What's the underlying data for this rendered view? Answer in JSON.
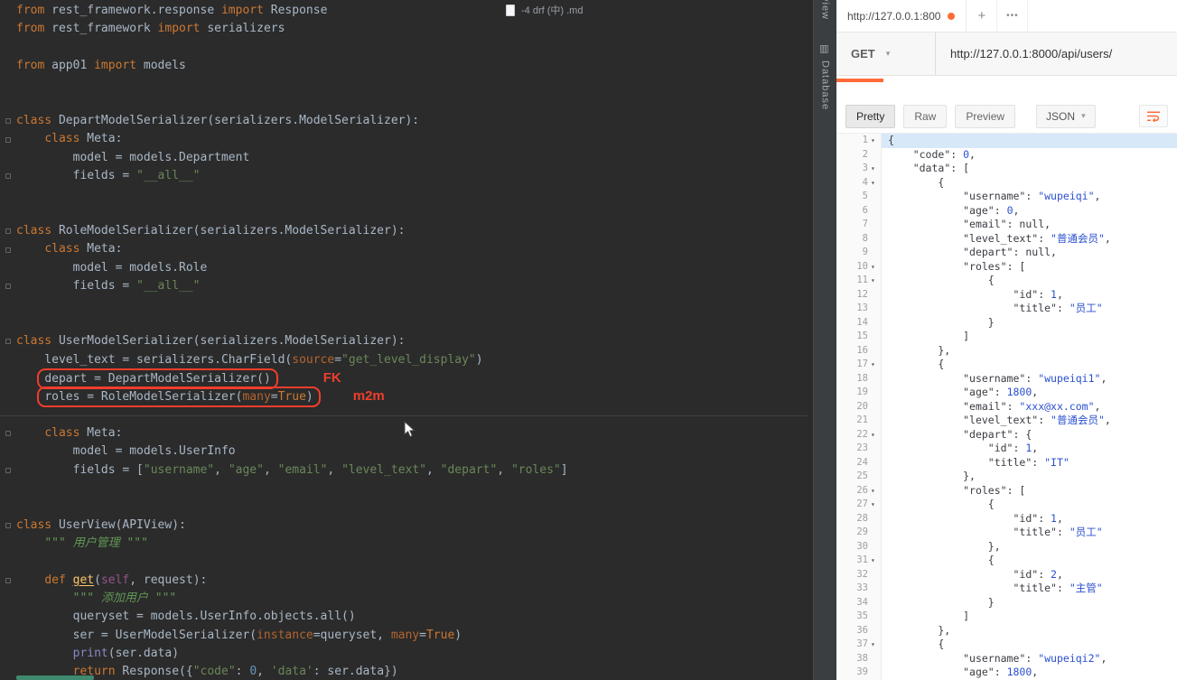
{
  "colors": {
    "accent": "#ff6c37",
    "annotation_red": "#f03e2d"
  },
  "editor": {
    "tab_filename": "-4 drf (中) .md",
    "tool_stripe": {
      "top": "view",
      "side": "Database"
    },
    "code_lines": [
      {
        "t": [
          [
            "k",
            "from"
          ],
          [
            "p",
            " rest_framework.response "
          ],
          [
            "k",
            "import"
          ],
          [
            "p",
            " Response"
          ]
        ]
      },
      {
        "t": [
          [
            "k",
            "from"
          ],
          [
            "p",
            " rest_framework "
          ],
          [
            "k",
            "import"
          ],
          [
            "p",
            " serializers"
          ]
        ]
      },
      {
        "t": []
      },
      {
        "t": [
          [
            "k",
            "from"
          ],
          [
            "p",
            " app01 "
          ],
          [
            "k",
            "import"
          ],
          [
            "p",
            " models"
          ]
        ]
      },
      {
        "t": []
      },
      {
        "t": []
      },
      {
        "f": 1,
        "t": [
          [
            "k",
            "class"
          ],
          [
            "p",
            " DepartModelSerializer(serializers.ModelSerializer):"
          ]
        ]
      },
      {
        "f": 1,
        "t": [
          [
            "p",
            "    "
          ],
          [
            "k",
            "class"
          ],
          [
            "p",
            " Meta:"
          ]
        ]
      },
      {
        "t": [
          [
            "p",
            "        model = models.Department"
          ]
        ]
      },
      {
        "f": 1,
        "t": [
          [
            "p",
            "        fields = "
          ],
          [
            "s",
            "\"__all__\""
          ]
        ]
      },
      {
        "t": []
      },
      {
        "t": []
      },
      {
        "f": 1,
        "t": [
          [
            "k",
            "class"
          ],
          [
            "p",
            " RoleModelSerializer(serializers.ModelSerializer):"
          ]
        ]
      },
      {
        "f": 1,
        "t": [
          [
            "p",
            "    "
          ],
          [
            "k",
            "class"
          ],
          [
            "p",
            " Meta:"
          ]
        ]
      },
      {
        "t": [
          [
            "p",
            "        model = models.Role"
          ]
        ]
      },
      {
        "f": 1,
        "t": [
          [
            "p",
            "        fields = "
          ],
          [
            "s",
            "\"__all__\""
          ]
        ]
      },
      {
        "t": []
      },
      {
        "t": []
      },
      {
        "f": 1,
        "t": [
          [
            "k",
            "class"
          ],
          [
            "p",
            " UserModelSerializer(serializers.ModelSerializer):"
          ]
        ]
      },
      {
        "t": [
          [
            "p",
            "    level_text = serializers.CharField("
          ],
          [
            "a",
            "source"
          ],
          [
            "p",
            "="
          ],
          [
            "s",
            "\"get_level_display\""
          ],
          [
            "p",
            ")"
          ]
        ]
      },
      {
        "box": 1,
        "note": "FK",
        "nm": 50,
        "t": [
          [
            "p",
            "    "
          ],
          [
            "p",
            "depart = DepartModelSerializer()"
          ]
        ]
      },
      {
        "box": 1,
        "note": "m2m",
        "nm": 36,
        "t": [
          [
            "p",
            "    "
          ],
          [
            "p",
            "roles = RoleModelSerializer("
          ],
          [
            "a",
            "many"
          ],
          [
            "p",
            "="
          ],
          [
            "k",
            "True"
          ],
          [
            "p",
            ")"
          ]
        ]
      },
      {
        "t": []
      },
      {
        "f": 1,
        "t": [
          [
            "p",
            "    "
          ],
          [
            "k",
            "class"
          ],
          [
            "p",
            " Meta:"
          ]
        ]
      },
      {
        "t": [
          [
            "p",
            "        model = models.UserInfo"
          ]
        ]
      },
      {
        "f": 1,
        "t": [
          [
            "p",
            "        fields = ["
          ],
          [
            "s",
            "\"username\""
          ],
          [
            "p",
            ", "
          ],
          [
            "s",
            "\"age\""
          ],
          [
            "p",
            ", "
          ],
          [
            "s",
            "\"email\""
          ],
          [
            "p",
            ", "
          ],
          [
            "s",
            "\"level_text\""
          ],
          [
            "p",
            ", "
          ],
          [
            "s",
            "\"depart\""
          ],
          [
            "p",
            ", "
          ],
          [
            "s",
            "\"roles\""
          ],
          [
            "p",
            "]"
          ]
        ]
      },
      {
        "t": []
      },
      {
        "t": []
      },
      {
        "f": 1,
        "t": [
          [
            "k",
            "class"
          ],
          [
            "p",
            " UserView(APIView):"
          ]
        ]
      },
      {
        "t": [
          [
            "p",
            "    "
          ],
          [
            "d",
            "\"\"\" 用户管理 \"\"\""
          ]
        ]
      },
      {
        "t": []
      },
      {
        "f": 1,
        "t": [
          [
            "p",
            "    "
          ],
          [
            "k",
            "def"
          ],
          [
            "p",
            " "
          ],
          [
            "fn",
            "get"
          ],
          [
            "p",
            "("
          ],
          [
            "e",
            "self"
          ],
          [
            "p",
            ", request):"
          ]
        ]
      },
      {
        "t": [
          [
            "p",
            "        "
          ],
          [
            "d",
            "\"\"\" 添加用户 \"\"\""
          ]
        ]
      },
      {
        "t": [
          [
            "p",
            "        queryset = models.UserInfo.objects.all()"
          ]
        ]
      },
      {
        "t": [
          [
            "p",
            "        ser = UserModelSerializer("
          ],
          [
            "a",
            "instance"
          ],
          [
            "p",
            "=queryset, "
          ],
          [
            "a",
            "many"
          ],
          [
            "p",
            "="
          ],
          [
            "k",
            "True"
          ],
          [
            "p",
            ")"
          ]
        ]
      },
      {
        "t": [
          [
            "p",
            "        "
          ],
          [
            "b",
            "print"
          ],
          [
            "p",
            "(ser.data)"
          ]
        ]
      },
      {
        "t": [
          [
            "p",
            "        "
          ],
          [
            "k",
            "return"
          ],
          [
            "p",
            " Response({"
          ],
          [
            "s",
            "\"code\""
          ],
          [
            "p",
            ": "
          ],
          [
            "n",
            "0"
          ],
          [
            "p",
            ", "
          ],
          [
            "s",
            "'data'"
          ],
          [
            "p",
            ": ser.data})"
          ]
        ]
      }
    ]
  },
  "postman": {
    "tabbar": {
      "title": "http://127.0.0.1:800",
      "plus": "+",
      "more": "•••"
    },
    "request": {
      "method": "GET",
      "chevron": "▾",
      "url": "http://127.0.0.1:8000/api/users/"
    },
    "toolbar": {
      "views": [
        "Pretty",
        "Raw",
        "Preview"
      ],
      "active": "Pretty",
      "format": "JSON",
      "chevron": "▾"
    },
    "body_lines": [
      {
        "f": 1,
        "h": 1,
        "t": [
          [
            "p",
            "{"
          ]
        ]
      },
      {
        "t": [
          [
            "p",
            "    "
          ],
          [
            "k",
            "\"code\""
          ],
          [
            "p",
            ": "
          ],
          [
            "n",
            "0"
          ],
          [
            "p",
            ","
          ]
        ]
      },
      {
        "f": 1,
        "t": [
          [
            "p",
            "    "
          ],
          [
            "k",
            "\"data\""
          ],
          [
            "p",
            ": ["
          ]
        ]
      },
      {
        "f": 1,
        "t": [
          [
            "p",
            "        {"
          ]
        ]
      },
      {
        "t": [
          [
            "p",
            "            "
          ],
          [
            "k",
            "\"username\""
          ],
          [
            "p",
            ": "
          ],
          [
            "s",
            "\"wupeiqi\""
          ],
          [
            "p",
            ","
          ]
        ]
      },
      {
        "t": [
          [
            "p",
            "            "
          ],
          [
            "k",
            "\"age\""
          ],
          [
            "p",
            ": "
          ],
          [
            "n",
            "0"
          ],
          [
            "p",
            ","
          ]
        ]
      },
      {
        "t": [
          [
            "p",
            "            "
          ],
          [
            "k",
            "\"email\""
          ],
          [
            "p",
            ": "
          ],
          [
            "u",
            "null"
          ],
          [
            "p",
            ","
          ]
        ]
      },
      {
        "t": [
          [
            "p",
            "            "
          ],
          [
            "k",
            "\"level_text\""
          ],
          [
            "p",
            ": "
          ],
          [
            "s",
            "\"普通会员\""
          ],
          [
            "p",
            ","
          ]
        ]
      },
      {
        "t": [
          [
            "p",
            "            "
          ],
          [
            "k",
            "\"depart\""
          ],
          [
            "p",
            ": "
          ],
          [
            "u",
            "null"
          ],
          [
            "p",
            ","
          ]
        ]
      },
      {
        "f": 1,
        "t": [
          [
            "p",
            "            "
          ],
          [
            "k",
            "\"roles\""
          ],
          [
            "p",
            ": ["
          ]
        ]
      },
      {
        "f": 1,
        "t": [
          [
            "p",
            "                {"
          ]
        ]
      },
      {
        "t": [
          [
            "p",
            "                    "
          ],
          [
            "k",
            "\"id\""
          ],
          [
            "p",
            ": "
          ],
          [
            "n",
            "1"
          ],
          [
            "p",
            ","
          ]
        ]
      },
      {
        "t": [
          [
            "p",
            "                    "
          ],
          [
            "k",
            "\"title\""
          ],
          [
            "p",
            ": "
          ],
          [
            "s",
            "\"员工\""
          ]
        ]
      },
      {
        "t": [
          [
            "p",
            "                }"
          ]
        ]
      },
      {
        "t": [
          [
            "p",
            "            ]"
          ]
        ]
      },
      {
        "t": [
          [
            "p",
            "        },"
          ]
        ]
      },
      {
        "f": 1,
        "t": [
          [
            "p",
            "        {"
          ]
        ]
      },
      {
        "t": [
          [
            "p",
            "            "
          ],
          [
            "k",
            "\"username\""
          ],
          [
            "p",
            ": "
          ],
          [
            "s",
            "\"wupeiqi1\""
          ],
          [
            "p",
            ","
          ]
        ]
      },
      {
        "t": [
          [
            "p",
            "            "
          ],
          [
            "k",
            "\"age\""
          ],
          [
            "p",
            ": "
          ],
          [
            "n",
            "1800"
          ],
          [
            "p",
            ","
          ]
        ]
      },
      {
        "t": [
          [
            "p",
            "            "
          ],
          [
            "k",
            "\"email\""
          ],
          [
            "p",
            ": "
          ],
          [
            "s",
            "\"xxx@xx.com\""
          ],
          [
            "p",
            ","
          ]
        ]
      },
      {
        "t": [
          [
            "p",
            "            "
          ],
          [
            "k",
            "\"level_text\""
          ],
          [
            "p",
            ": "
          ],
          [
            "s",
            "\"普通会员\""
          ],
          [
            "p",
            ","
          ]
        ]
      },
      {
        "f": 1,
        "t": [
          [
            "p",
            "            "
          ],
          [
            "k",
            "\"depart\""
          ],
          [
            "p",
            ": {"
          ]
        ]
      },
      {
        "t": [
          [
            "p",
            "                "
          ],
          [
            "k",
            "\"id\""
          ],
          [
            "p",
            ": "
          ],
          [
            "n",
            "1"
          ],
          [
            "p",
            ","
          ]
        ]
      },
      {
        "t": [
          [
            "p",
            "                "
          ],
          [
            "k",
            "\"title\""
          ],
          [
            "p",
            ": "
          ],
          [
            "s",
            "\"IT\""
          ]
        ]
      },
      {
        "t": [
          [
            "p",
            "            },"
          ]
        ]
      },
      {
        "f": 1,
        "t": [
          [
            "p",
            "            "
          ],
          [
            "k",
            "\"roles\""
          ],
          [
            "p",
            ": ["
          ]
        ]
      },
      {
        "f": 1,
        "t": [
          [
            "p",
            "                {"
          ]
        ]
      },
      {
        "t": [
          [
            "p",
            "                    "
          ],
          [
            "k",
            "\"id\""
          ],
          [
            "p",
            ": "
          ],
          [
            "n",
            "1"
          ],
          [
            "p",
            ","
          ]
        ]
      },
      {
        "t": [
          [
            "p",
            "                    "
          ],
          [
            "k",
            "\"title\""
          ],
          [
            "p",
            ": "
          ],
          [
            "s",
            "\"员工\""
          ]
        ]
      },
      {
        "t": [
          [
            "p",
            "                },"
          ]
        ]
      },
      {
        "f": 1,
        "t": [
          [
            "p",
            "                {"
          ]
        ]
      },
      {
        "t": [
          [
            "p",
            "                    "
          ],
          [
            "k",
            "\"id\""
          ],
          [
            "p",
            ": "
          ],
          [
            "n",
            "2"
          ],
          [
            "p",
            ","
          ]
        ]
      },
      {
        "t": [
          [
            "p",
            "                    "
          ],
          [
            "k",
            "\"title\""
          ],
          [
            "p",
            ": "
          ],
          [
            "s",
            "\"主管\""
          ]
        ]
      },
      {
        "t": [
          [
            "p",
            "                }"
          ]
        ]
      },
      {
        "t": [
          [
            "p",
            "            ]"
          ]
        ]
      },
      {
        "t": [
          [
            "p",
            "        },"
          ]
        ]
      },
      {
        "f": 1,
        "t": [
          [
            "p",
            "        {"
          ]
        ]
      },
      {
        "t": [
          [
            "p",
            "            "
          ],
          [
            "k",
            "\"username\""
          ],
          [
            "p",
            ": "
          ],
          [
            "s",
            "\"wupeiqi2\""
          ],
          [
            "p",
            ","
          ]
        ]
      },
      {
        "t": [
          [
            "p",
            "            "
          ],
          [
            "k",
            "\"age\""
          ],
          [
            "p",
            ": "
          ],
          [
            "n",
            "1800"
          ],
          [
            "p",
            ","
          ]
        ]
      }
    ]
  }
}
